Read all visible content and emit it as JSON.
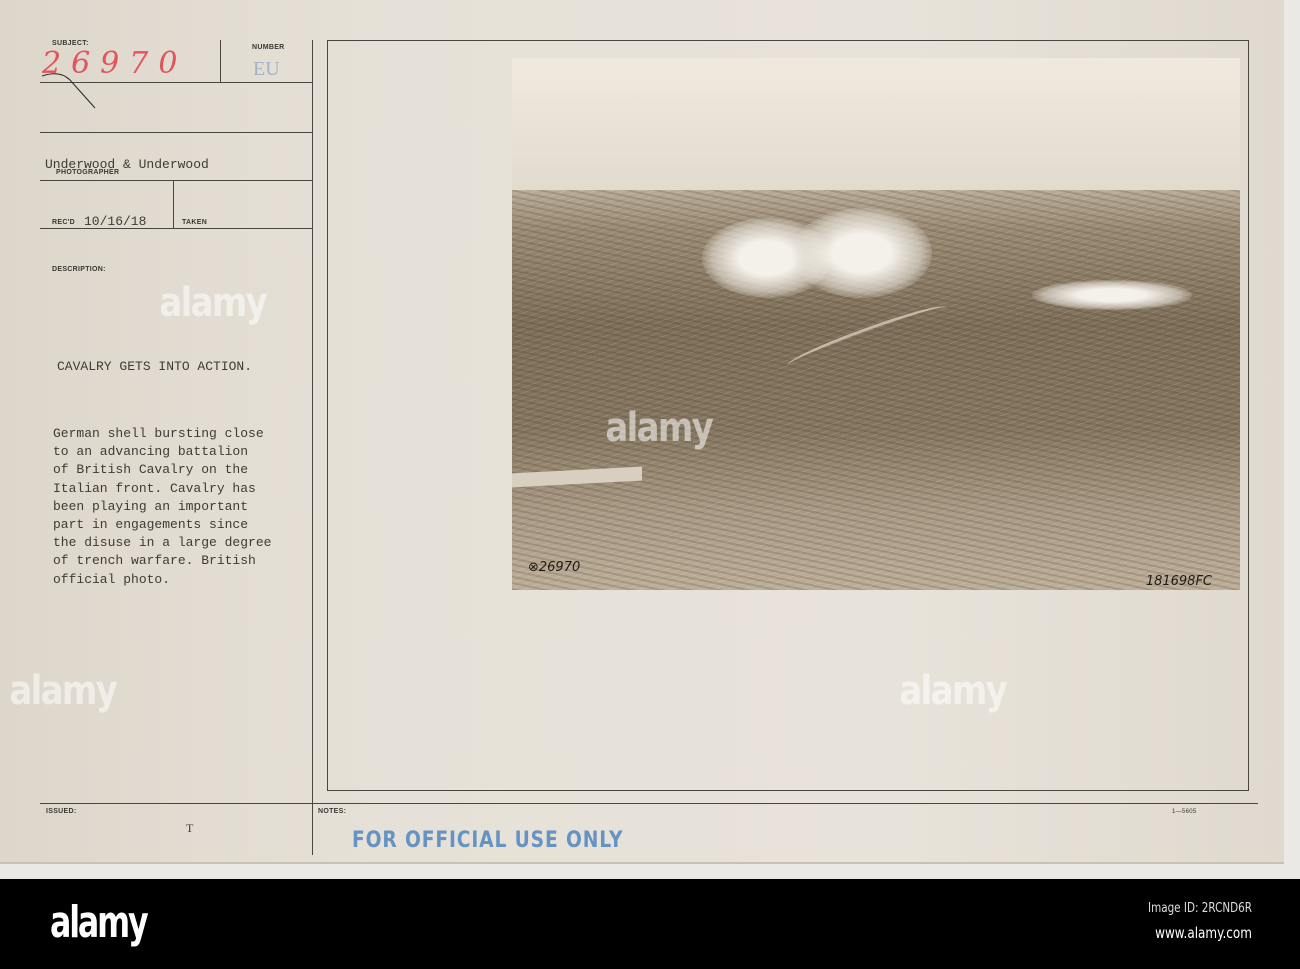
{
  "card": {
    "labels": {
      "subject": "SUBJECT:",
      "number": "NUMBER",
      "photographer": "PHOTOGRAPHER",
      "recd": "REC'D",
      "taken": "TAKEN",
      "description": "DESCRIPTION:",
      "issued": "ISSUED:",
      "notes": "NOTES:"
    },
    "subject_handwritten": "26970",
    "number_value": "EU",
    "photographer_value": "Underwood & Underwood",
    "recd_value": "10/16/18",
    "title": "CAVALRY GETS INTO ACTION.",
    "description": "German shell bursting close\nto an advancing battalion\nof British Cavalry on the\nItalian front. Cavalry has\nbeen playing an important\npart in engagements since\nthe disuse in a large degree\nof trench warfare. British\nofficial photo.",
    "issued_mark": "T",
    "stamp": "FOR OFFICIAL USE ONLY",
    "form_number": "1—5605"
  },
  "photo": {
    "number_left": "⊗26970",
    "number_right": "181698FC"
  },
  "watermark": "alamy",
  "footer": {
    "logo": "alamy",
    "image_id": "Image ID: 2RCND6R",
    "url": "www.alamy.com"
  }
}
